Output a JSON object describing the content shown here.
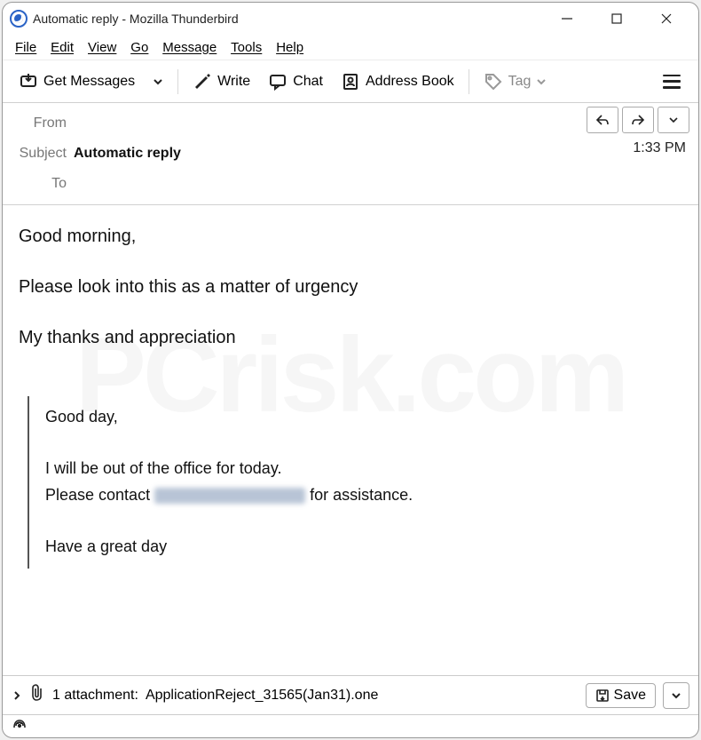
{
  "window": {
    "title": "Automatic reply - Mozilla Thunderbird"
  },
  "menubar": [
    "File",
    "Edit",
    "View",
    "Go",
    "Message",
    "Tools",
    "Help"
  ],
  "toolbar": {
    "getmessages": "Get Messages",
    "write": "Write",
    "chat": "Chat",
    "addressbook": "Address Book",
    "tag": "Tag"
  },
  "headers": {
    "from_label": "From",
    "from_value": "",
    "subject_label": "Subject",
    "subject_value": "Automatic reply",
    "to_label": "To",
    "to_value": "",
    "time": "1:33 PM"
  },
  "body": {
    "l1": "Good morning,",
    "l2": "Please look into this as a matter of urgency",
    "l3": "My thanks and appreciation",
    "q1": "Good day,",
    "q2": "I will be out of the office for today.",
    "q3a": "Please contact ",
    "q3b": " for assistance.",
    "q4": "Have a great day"
  },
  "attachment": {
    "count_label": "1 attachment: ",
    "filename": "ApplicationReject_31565(Jan31).one",
    "save": "Save"
  }
}
